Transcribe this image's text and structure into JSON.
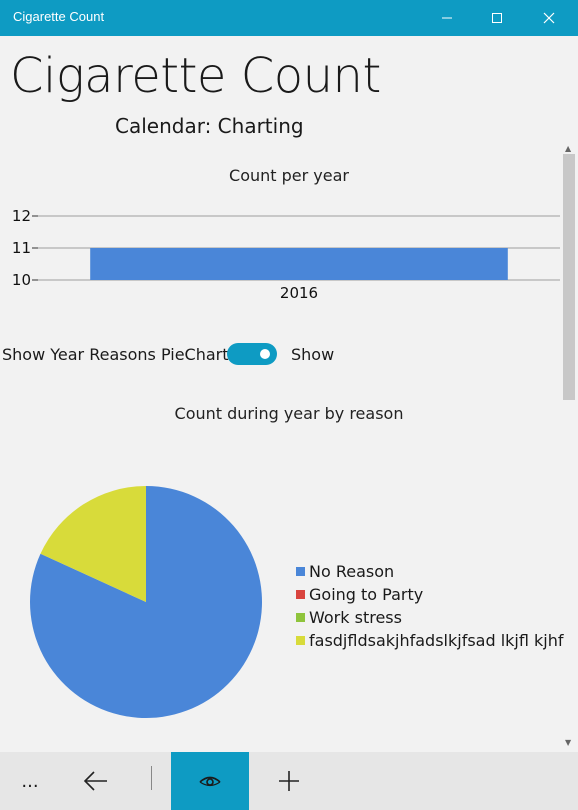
{
  "window": {
    "title": "Cigarette Count"
  },
  "header": {
    "title": "Cigarette Count",
    "subtitle": "Calendar: Charting"
  },
  "bar_chart_title": "Count per year",
  "toggle": {
    "label": "Show Year Reasons PieChart",
    "state_text": "Show",
    "on": true
  },
  "pie_chart_title": "Count during year by reason",
  "chart_data": [
    {
      "type": "bar",
      "title": "Count per year",
      "categories": [
        "2016"
      ],
      "values": [
        11
      ],
      "ylim": [
        10,
        12
      ],
      "yticks": [
        10,
        11,
        12
      ],
      "grid": true,
      "color": "#4a86d8"
    },
    {
      "type": "pie",
      "title": "Count during year by reason",
      "labels": [
        "No Reason",
        "Going to Party",
        "Work stress",
        "fasdjfldsakjhfadslkjfsad lkjfl kjhf"
      ],
      "values": [
        9,
        0,
        0,
        2
      ],
      "colors": [
        "#4a86d8",
        "#d9443e",
        "#8fc43c",
        "#d8db3a"
      ],
      "legend": "right"
    }
  ],
  "appbar": {
    "more": "...",
    "buttons": [
      "back-arrow-icon",
      "eye-icon",
      "plus-icon"
    ]
  }
}
